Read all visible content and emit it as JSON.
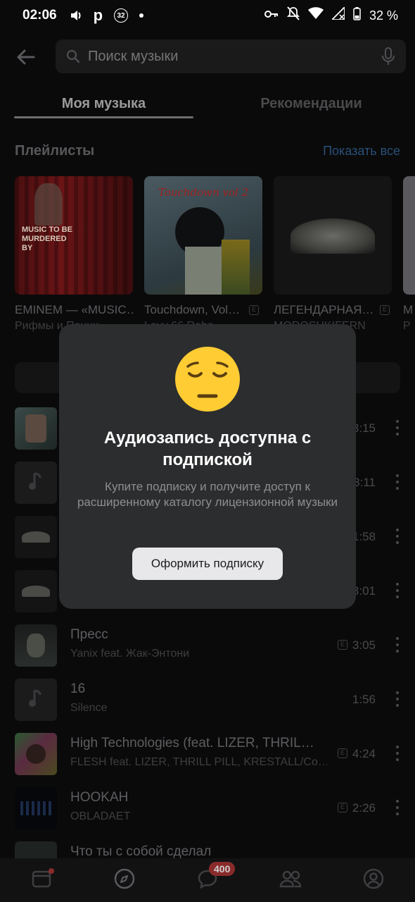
{
  "status_bar": {
    "time": "02:06",
    "notification_count": "32",
    "battery": "32 %"
  },
  "search": {
    "placeholder": "Поиск музыки"
  },
  "tabs": [
    {
      "label": "Моя музыка"
    },
    {
      "label": "Рекомендации"
    }
  ],
  "playlists_section": {
    "title": "Плейлисты",
    "show_all": "Показать все",
    "items": [
      {
        "name": "EMINEM — «MUSIC…",
        "subtitle": "Рифмы и Панчи",
        "cover_text": "MUSIC TO BE MURDERED BY"
      },
      {
        "name": "Touchdown, Vol…",
        "subtitle": "Lovv 66 Robo…",
        "cover_text": "Touchdown vol 2"
      },
      {
        "name": "ЛЕГЕНДАРНАЯ…",
        "subtitle": "MOROSHKIFERN",
        "cover_text": ""
      },
      {
        "name": "M",
        "subtitle": "Р",
        "cover_text": ""
      }
    ]
  },
  "tracks": [
    {
      "title": "",
      "artist": "",
      "duration": "3:15",
      "explicit": false
    },
    {
      "title": "",
      "artist": "",
      "duration": "3:11",
      "explicit": false
    },
    {
      "title": "",
      "artist": "",
      "duration": "1:58",
      "explicit": false
    },
    {
      "title": "",
      "artist": "",
      "duration": "3:01",
      "explicit": false
    },
    {
      "title": "Пресс",
      "artist": "Yanix feat. Жак-Энтони",
      "duration": "3:05",
      "explicit": true
    },
    {
      "title": "16",
      "artist": "Silence",
      "duration": "1:56",
      "explicit": false
    },
    {
      "title": "High Technologies (feat. LIZER, THRIL…",
      "artist": "FLESH feat. LIZER, THRILL PILL, KRESTALL/Co…",
      "duration": "4:24",
      "explicit": true
    },
    {
      "title": "HOOKAH",
      "artist": "OBLADAET",
      "duration": "2:26",
      "explicit": true
    },
    {
      "title": "Что ты с собой сделал",
      "artist": "",
      "duration": "",
      "explicit": false
    }
  ],
  "bottom_nav": {
    "messages_count": "400"
  },
  "modal": {
    "title": "Аудиозапись доступна с подпиской",
    "text": "Купите подписку и получите доступ к расширенному каталогу лицензионной музыки",
    "button": "Оформить подписку"
  }
}
